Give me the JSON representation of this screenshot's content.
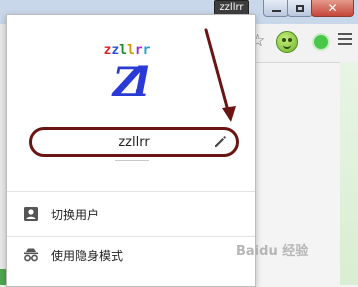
{
  "window": {
    "profile_badge": "zzllrr",
    "minimize_label": "minimize",
    "maximize_label": "maximize",
    "close_glyph": "✕"
  },
  "toolbar": {
    "bookmark_icon": "star-icon",
    "extension_icon": "green-face-icon",
    "extension2_icon": "green-dot-icon",
    "menu_icon": "hamburger-menu-icon",
    "star_glyph": "☆"
  },
  "profile_popup": {
    "avatar_letters": [
      "z",
      "z",
      "l",
      "l",
      "r",
      "r"
    ],
    "avatar_logo": "Zl",
    "user_name": "zzllrr",
    "edit_icon": "pencil-icon",
    "items": [
      {
        "label": "切换用户",
        "icon": "person-badge-icon"
      },
      {
        "label": "使用隐身模式",
        "icon": "incognito-icon"
      }
    ]
  },
  "watermark": "Baidu 经验",
  "colors": {
    "highlight_ellipse": "#6b1414",
    "arrow": "#6b1414",
    "accent_green": "#49c749"
  }
}
